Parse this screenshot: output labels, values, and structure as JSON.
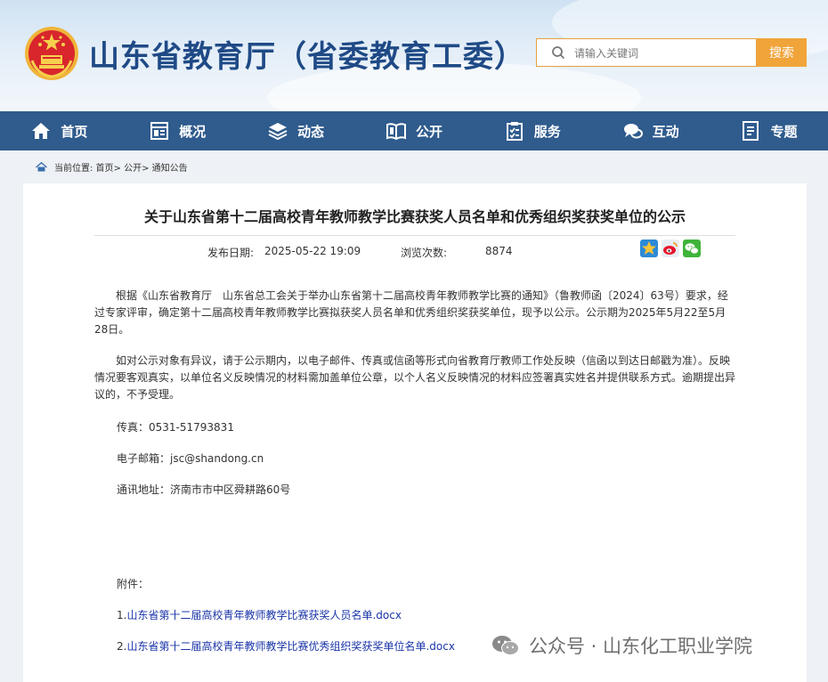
{
  "header": {
    "site_title": "山东省教育厅（省委教育工委）",
    "search_placeholder": "请输入关键词",
    "search_button": "搜索"
  },
  "nav": {
    "items": [
      {
        "label": "首页",
        "icon": "home-icon"
      },
      {
        "label": "概况",
        "icon": "overview-icon"
      },
      {
        "label": "动态",
        "icon": "layers-icon"
      },
      {
        "label": "公开",
        "icon": "book-icon"
      },
      {
        "label": "服务",
        "icon": "clipboard-icon"
      },
      {
        "label": "互动",
        "icon": "chat-icon"
      },
      {
        "label": "专题",
        "icon": "document-icon"
      }
    ]
  },
  "breadcrumb": {
    "text": "当前位置: 首页> 公开> 通知公告"
  },
  "article": {
    "title": "关于山东省第十二届高校青年教师教学比赛获奖人员名单和优秀组织奖获奖单位的公示",
    "date_label": "发布日期:",
    "date_value": "2025-05-22 19:09",
    "views_label": "浏览次数:",
    "views_value": "8874",
    "paragraph1": "根据《山东省教育厅　山东省总工会关于举办山东省第十二届高校青年教师教学比赛的通知》（鲁教师函〔2024〕63号）要求，经过专家评审，确定第十二届高校青年教师教学比赛拟获奖人员名单和优秀组织奖获奖单位，现予以公示。公示期为2025年5月22至5月28日。",
    "paragraph2": "如对公示对象有异议，请于公示期内，以电子邮件、传真或信函等形式向省教育厅教师工作处反映（信函以到达日邮戳为准）。反映情况要客观真实，以单位名义反映情况的材料需加盖单位公章，以个人名义反映情况的材料应签署真实姓名并提供联系方式。逾期提出异议的，不予受理。",
    "fax": "传真：0531-51793831",
    "email": "电子邮箱：jsc@shandong.cn",
    "address": "通讯地址：济南市市中区舜耕路60号",
    "attachments_label": "附件：",
    "attachments": [
      {
        "prefix": "1.",
        "name": "山东省第十二届高校青年教师教学比赛获奖人员名单.docx"
      },
      {
        "prefix": "2.",
        "name": "山东省第十二届高校青年教师教学比赛优秀组织奖获奖单位名单.docx"
      }
    ]
  },
  "watermark": {
    "text": "公众号 · 山东化工职业学院"
  },
  "colors": {
    "nav_bg": "#2f5b8d",
    "title_blue": "#1f4a86",
    "search_orange": "#f0a43a",
    "link_blue": "#1a35a8"
  }
}
